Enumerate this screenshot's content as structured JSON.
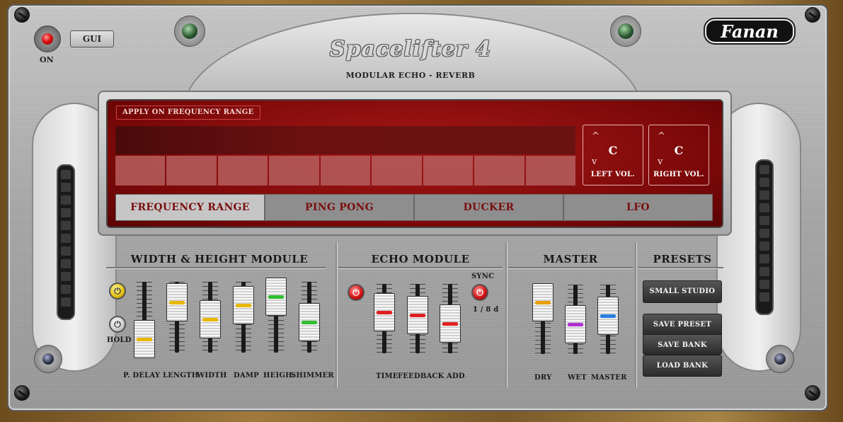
{
  "header": {
    "power_label": "ON",
    "gui_label": "GUI",
    "title": "Spacelifter 4",
    "subtitle": "MODULAR ECHO - REVERB",
    "brand": "Fanan"
  },
  "display": {
    "apply_label": "APPLY ON FREQUENCY RANGE",
    "left_vol": {
      "value": "C",
      "label": "LEFT VOL.",
      "up": "^",
      "down": "v"
    },
    "right_vol": {
      "value": "C",
      "label": "RIGHT VOL.",
      "up": "^",
      "down": "v"
    },
    "tabs": [
      {
        "label": "FREQUENCY RANGE",
        "active": true
      },
      {
        "label": "PING PONG",
        "active": false
      },
      {
        "label": "DUCKER",
        "active": false
      },
      {
        "label": "LFO",
        "active": false
      }
    ]
  },
  "width_height": {
    "title": "WIDTH & HEIGHT MODULE",
    "hold_label": "HOLD",
    "sliders": [
      {
        "label": "P. DELAY",
        "value": 0.2,
        "color": "#e8b800"
      },
      {
        "label": "LENGTH",
        "value": 0.85,
        "color": "#e8b800"
      },
      {
        "label": "WIDTH",
        "value": 0.55,
        "color": "#e8b800"
      },
      {
        "label": "DAMP",
        "value": 0.8,
        "color": "#e8b800"
      },
      {
        "label": "HEIGH.",
        "value": 0.95,
        "color": "#2fbf2f"
      },
      {
        "label": "SHIMMER",
        "value": 0.5,
        "color": "#2fbf2f"
      }
    ]
  },
  "echo": {
    "title": "ECHO MODULE",
    "sync_label": "SYNC",
    "sync_value": "1 / 8 d",
    "sliders": [
      {
        "label": "TIME",
        "value": 0.7,
        "color": "#e02020"
      },
      {
        "label": "FEEDBACK",
        "value": 0.65,
        "color": "#e02020"
      },
      {
        "label": "ADD",
        "value": 0.5,
        "color": "#e02020"
      }
    ]
  },
  "master": {
    "title": "MASTER",
    "sliders": [
      {
        "label": "DRY",
        "value": 0.9,
        "color": "#e8a000"
      },
      {
        "label": "WET",
        "value": 0.5,
        "color": "#b030d0"
      },
      {
        "label": "MASTER",
        "value": 0.65,
        "color": "#2a80e0"
      }
    ]
  },
  "presets": {
    "title": "PRESETS",
    "current": "SMALL STUDIO",
    "save_preset": "SAVE PRESET",
    "save_bank": "SAVE BANK",
    "load_bank": "LOAD BANK"
  }
}
